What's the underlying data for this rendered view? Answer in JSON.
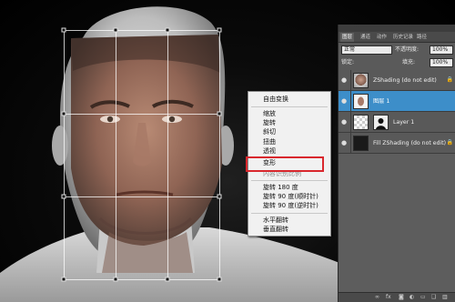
{
  "context_menu": {
    "items": [
      {
        "label": "自由变换",
        "disabled": false
      },
      {
        "label": "缩放",
        "disabled": false
      },
      {
        "label": "旋转",
        "disabled": false
      },
      {
        "label": "斜切",
        "disabled": false
      },
      {
        "label": "扭曲",
        "disabled": false
      },
      {
        "label": "透视",
        "disabled": false
      },
      {
        "label": "变形",
        "disabled": false
      },
      {
        "label": "内容识别比例",
        "disabled": true
      },
      {
        "label": "旋转 180 度",
        "disabled": false
      },
      {
        "label": "旋转 90 度(顺时针)",
        "disabled": false
      },
      {
        "label": "旋转 90 度(逆时针)",
        "disabled": false
      },
      {
        "label": "水平翻转",
        "disabled": false
      },
      {
        "label": "垂直翻转",
        "disabled": false
      }
    ],
    "highlighted_item": "变形",
    "highlight_color": "#d9272d"
  },
  "layers_panel": {
    "tabs": [
      "图层",
      "通道",
      "动作",
      "历史记录",
      "路径"
    ],
    "active_tab": "图层",
    "blend_mode": "正常",
    "opacity_label": "不透明度:",
    "opacity_value": "100%",
    "fill_label": "填充:",
    "fill_value": "100%",
    "lock_label": "锁定:",
    "layers": [
      {
        "name": "ZShading (do not edit)",
        "selected": false,
        "locked": true,
        "thumb": "face"
      },
      {
        "name": "图层 1",
        "selected": true,
        "locked": false,
        "thumb": "face-small"
      },
      {
        "name": "Layer 1",
        "selected": false,
        "locked": false,
        "thumb": "checker",
        "has_mask": true
      },
      {
        "name": "Fill ZShading (do not edit)",
        "selected": false,
        "locked": true,
        "thumb": "dark"
      }
    ],
    "selected_color": "#3d8ec9",
    "bottom_icons": [
      "link-icon",
      "fx-icon",
      "mask-icon",
      "adjustment-icon",
      "folder-icon",
      "new-layer-icon",
      "trash-icon"
    ]
  }
}
